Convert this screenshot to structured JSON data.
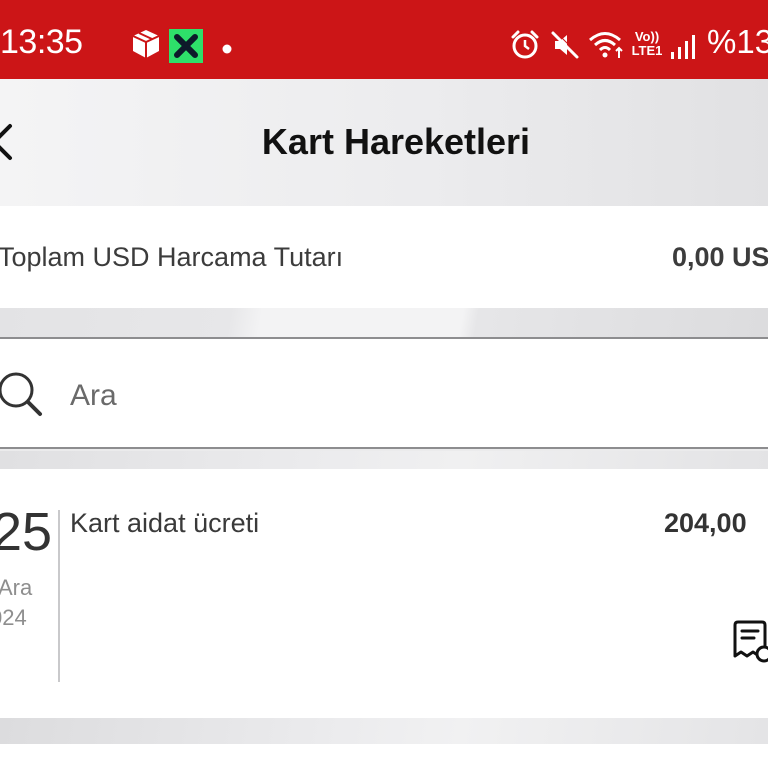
{
  "status_bar": {
    "time": "13:35",
    "battery": "%13",
    "network_label": "Vo)) LTE1",
    "background_color": "#cc1517",
    "icons": [
      "package-icon",
      "app-x-icon",
      "notification-dot-icon",
      "alarm-icon",
      "mute-icon",
      "wifi-icon",
      "signal-icon"
    ]
  },
  "header": {
    "title": "Kart Hareketleri",
    "back_icon": "back-chevron-icon"
  },
  "summary": {
    "label": "Toplam USD Harcama Tutarı",
    "value": "0,00 US"
  },
  "search": {
    "placeholder": "Ara",
    "icon": "search-icon"
  },
  "transactions": [
    {
      "day": "25",
      "month": "Ara",
      "year": "024",
      "description": "Kart aidat ücreti",
      "amount": "204,00",
      "icon": "receipt-icon"
    }
  ]
}
